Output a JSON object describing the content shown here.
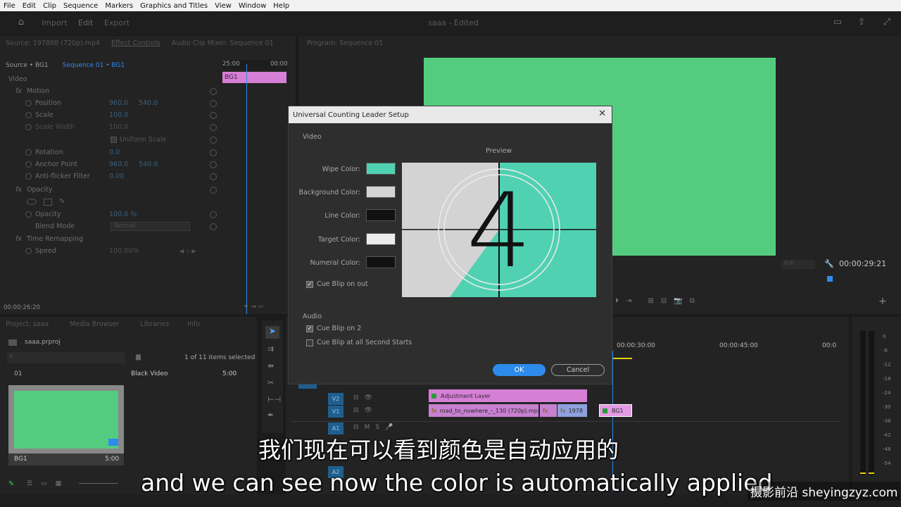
{
  "menu": [
    "File",
    "Edit",
    "Clip",
    "Sequence",
    "Markers",
    "Graphics and Titles",
    "View",
    "Window",
    "Help"
  ],
  "header": {
    "workspaces": [
      "Import",
      "Edit",
      "Export"
    ],
    "doc_title": "saaa - Edited"
  },
  "source_tabs": {
    "source": "Source: 197898 (720p).mp4",
    "effect_controls": "Effect Controls",
    "audio_mixer": "Audio Clip Mixer: Sequence 01"
  },
  "effect_controls": {
    "source_label": "Source • BG1",
    "sequence_label": "Sequence 01 • BG1",
    "ruler_times": [
      "25:00",
      "00:00"
    ],
    "clip_label": "BG1",
    "section_video": "Video",
    "motion": "Motion",
    "position": {
      "label": "Position",
      "x": "960.0",
      "y": "540.0"
    },
    "scale": {
      "label": "Scale",
      "value": "100.0"
    },
    "scale_width": {
      "label": "Scale Width",
      "value": "100.0"
    },
    "uniform_scale": "Uniform Scale",
    "rotation": {
      "label": "Rotation",
      "value": "0.0"
    },
    "anchor": {
      "label": "Anchor Point",
      "x": "960.0",
      "y": "540.0"
    },
    "antiflicker": {
      "label": "Anti-flicker Filter",
      "value": "0.00"
    },
    "opacity": "Opacity",
    "opacity_prop": {
      "label": "Opacity",
      "value": "100.0 %"
    },
    "blend": {
      "label": "Blend Mode",
      "value": "Normal"
    },
    "time_remap": "Time Remapping",
    "speed": {
      "label": "Speed",
      "value": "100.00%"
    },
    "timecode": "00:00:26:20"
  },
  "program": {
    "title": "Program: Sequence 01",
    "fit": "Full",
    "timecode": "00:00:29:21"
  },
  "project": {
    "tabs": [
      "Project: saaa",
      "Media Browser",
      "Libraries",
      "Info"
    ],
    "file": "saaa.prproj",
    "selection": "1 of 11 items selected",
    "item_number": "01",
    "thumb_name": "BG1",
    "thumb_duration": "5:00",
    "list_item_name": "Black Video",
    "list_item_duration": "5:00"
  },
  "timeline": {
    "times": [
      "00:00:30:00",
      "00:00:45:00",
      "00:0"
    ],
    "tracks": [
      "V2",
      "V1",
      "A1",
      "A2"
    ],
    "clips": {
      "adjustment": "Adjustment Layer",
      "road": "road_to_nowhere_-_130 (720p).mp4",
      "c1978": "1978",
      "bg1": "BG1"
    }
  },
  "meter_labels": [
    "0",
    "-6",
    "-12",
    "-18",
    "-24",
    "-30",
    "-36",
    "-42",
    "-48",
    "-54"
  ],
  "dialog": {
    "title": "Universal Counting Leader Setup",
    "close": "✕",
    "video_section": "Video",
    "preview_label": "Preview",
    "colors": [
      {
        "label": "Wipe Color:",
        "hex": "#4fd1b2"
      },
      {
        "label": "Background Color:",
        "hex": "#d3d3d3"
      },
      {
        "label": "Line Color:",
        "hex": "#111111"
      },
      {
        "label": "Target Color:",
        "hex": "#ececec"
      },
      {
        "label": "Numeral Color:",
        "hex": "#121212"
      }
    ],
    "cue_blip_out": "Cue Blip on out",
    "preview_number": "4",
    "audio_section": "Audio",
    "cue_blip_2": "Cue Blip on 2",
    "cue_blip_all": "Cue Blip at all Second Starts",
    "ok": "OK",
    "cancel": "Cancel"
  },
  "colors": {
    "program_green": "#54cc7f",
    "wipe_teal": "#4fd1b2",
    "clip_pink": "#d67fd6",
    "accent_blue": "#2d8ceb"
  },
  "subtitles": {
    "chinese": "我们现在可以看到颜色是自动应用的",
    "english": "and we can see now the color is automatically applied"
  },
  "watermark": "摄影前沿 sheyingzyz.com"
}
